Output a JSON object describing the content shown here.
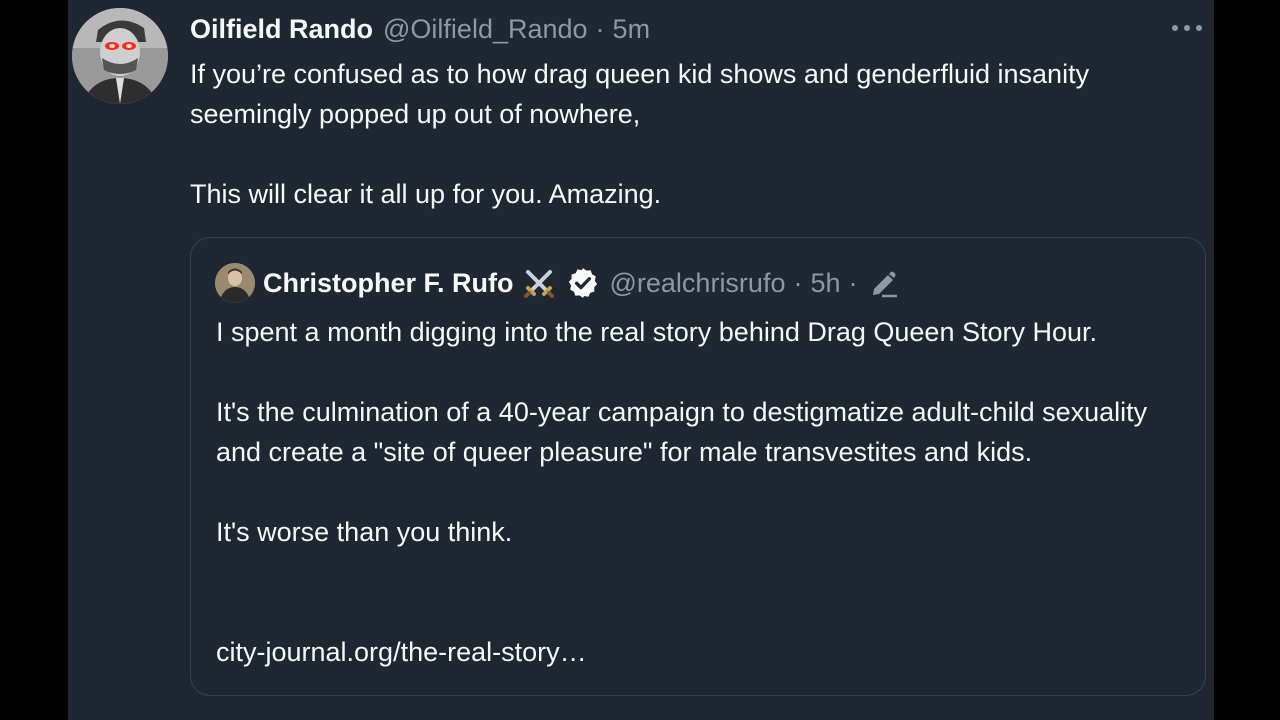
{
  "tweet": {
    "display_name": "Oilfield Rando",
    "handle": "@Oilfield_Rando",
    "separator": "·",
    "time": "5m",
    "text": "If you’re confused as to how drag queen kid shows and genderfluid insanity seemingly popped up out of nowhere,\n\nThis will clear it all up for you. Amazing.",
    "more_icon": "more-horizontal-icon"
  },
  "quoted": {
    "display_name": "Christopher F. Rufo",
    "name_emoji_icon": "crossed-swords-icon",
    "verified_icon": "verified-badge-icon",
    "handle": "@realchrisrufo",
    "separator": "·",
    "time": "5h",
    "separator2": "·",
    "edit_icon": "edit-pencil-icon",
    "text": "I spent a month digging into the real story behind Drag Queen Story Hour.\n\nIt's the culmination of a 40-year campaign to destigmatize adult-child sexuality and create  a \"site of queer pleasure\" for male transvestites and kids.\n\nIt's worse than you think.",
    "link": "city-journal.org/the-real-story…"
  },
  "colors": {
    "background": "#1e2732",
    "primary_text": "#f7f9f9",
    "secondary_text": "#8b98a5",
    "border": "#38444d",
    "letterbox": "#000000"
  }
}
